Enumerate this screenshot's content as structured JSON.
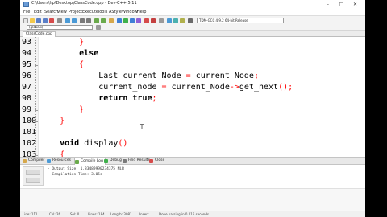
{
  "window": {
    "title": "C:\\Users\\hp\\Desktop\\ClassCode.cpp - Dev-C++ 5.11"
  },
  "menu": [
    "File",
    "Edit",
    "Search",
    "View",
    "Project",
    "Execute",
    "Tools",
    "AStyle",
    "Window",
    "Help"
  ],
  "toolbar": {
    "compiler": "TDM-GCC 4.9.2 64-bit Release",
    "globals": "(globals)"
  },
  "tabs": [
    "ClassCode.cpp"
  ],
  "editor": {
    "lines": [
      {
        "num": "93",
        "indent": "        ",
        "text": "}"
      },
      {
        "num": "94",
        "indent": "        ",
        "text": "else"
      },
      {
        "num": "95",
        "indent": "        ",
        "text": "{"
      },
      {
        "num": "96",
        "indent": "            ",
        "text": "Last_current_Node = current_Node;"
      },
      {
        "num": "97",
        "indent": "            ",
        "text": "current_node = current_Node->get_next();"
      },
      {
        "num": "98",
        "indent": "            ",
        "text": "return true;"
      },
      {
        "num": "99",
        "indent": "        ",
        "text": "}"
      },
      {
        "num": "100",
        "indent": "    ",
        "text": "}"
      },
      {
        "num": "101",
        "indent": "",
        "text": ""
      },
      {
        "num": "102",
        "indent": "    ",
        "text": "void display()"
      },
      {
        "num": "103",
        "indent": "    ",
        "text": "{"
      }
    ],
    "cursor_glyph": "I"
  },
  "panel": {
    "tabs": [
      "Compiler",
      "Resources",
      "Compile Log",
      "Debug",
      "Find Results",
      "Close"
    ],
    "active_tab": "Compile Log",
    "output": [
      "- Output Size: 1.83489990234375 MiB",
      "- Compilation Time: 3.05s"
    ]
  },
  "status": {
    "line": "Line: 111",
    "col": "Col: 26",
    "sel": "Sel: 0",
    "lines": "Lines: 184",
    "length": "Length: 3081",
    "mode": "Insert",
    "parse": "Done parsing in 0.016 seconds"
  },
  "colors": {
    "operator": "#ff0000",
    "editor_bg": "#ffffff",
    "gutter_bg": "#f4f4f4"
  }
}
